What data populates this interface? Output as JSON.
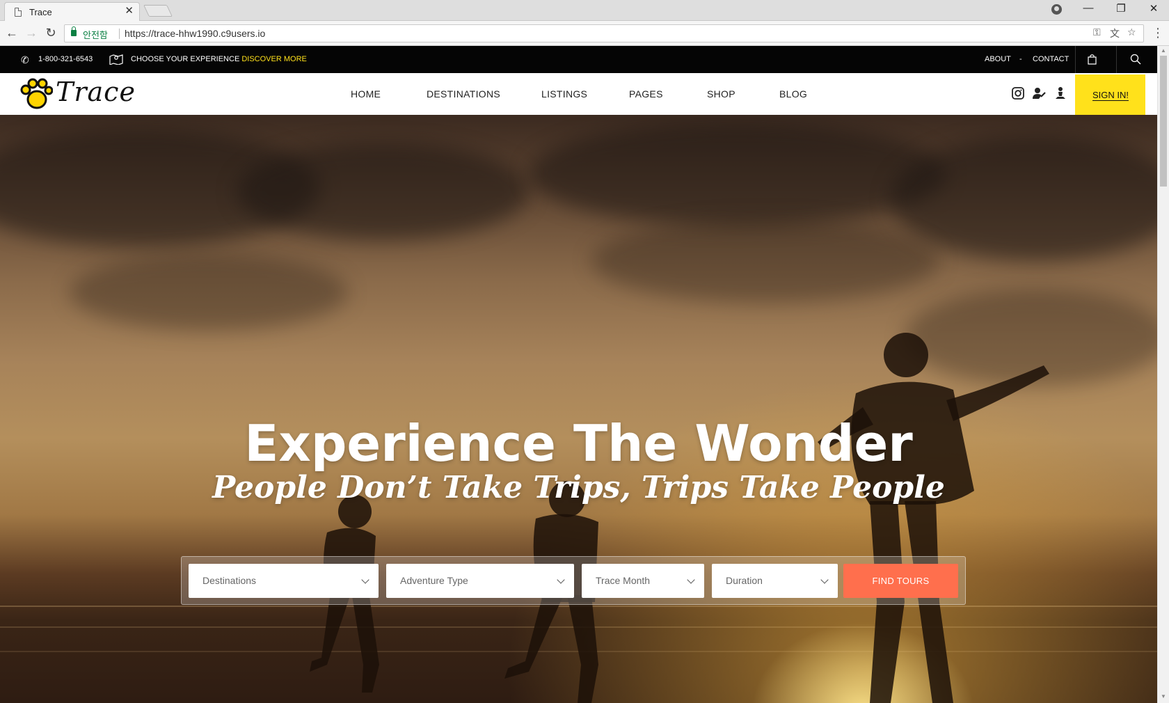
{
  "browser": {
    "tab_title": "Trace",
    "secure_label": "안전함",
    "url": "https://trace-hhw1990.c9users.io"
  },
  "topbar": {
    "phone": "1-800-321-6543",
    "choose_text": "CHOOSE YOUR EXPERIENCE",
    "discover_link": "DISCOVER MORE",
    "about": "ABOUT",
    "separator": "-",
    "contact": "CONTACT"
  },
  "nav": {
    "logo_text": "Trace",
    "items": [
      {
        "label": "HOME",
        "active": true
      },
      {
        "label": "DESTINATIONS"
      },
      {
        "label": "LISTINGS"
      },
      {
        "label": "PAGES"
      },
      {
        "label": "SHOP"
      },
      {
        "label": "BLOG"
      }
    ],
    "signin": "SIGN IN!",
    "social_icons": [
      "instagram-icon",
      "user-add-icon",
      "person-icon"
    ]
  },
  "hero": {
    "title": "Experience The Wonder",
    "subtitle": "People Don’t Take Trips, Trips Take People"
  },
  "search": {
    "destinations": "Destinations",
    "adventure_type": "Adventure Type",
    "trace_month": "Trace Month",
    "duration": "Duration",
    "button": "FIND TOURS"
  },
  "colors": {
    "accent_yellow": "#ffe11b",
    "find_button": "#ff6f4d",
    "topbar_bg": "#050505"
  }
}
